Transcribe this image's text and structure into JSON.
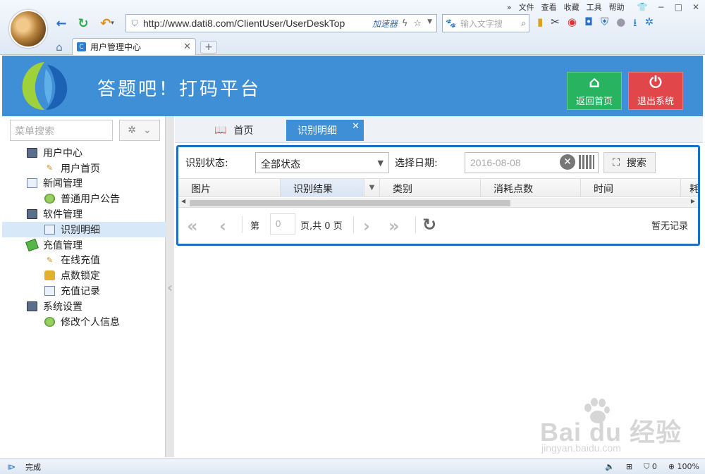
{
  "browser": {
    "menu": [
      "文件",
      "查看",
      "收藏",
      "工具",
      "帮助"
    ],
    "url": "http://www.dati8.com/ClientUser/UserDeskTop",
    "accelerator": "加速器",
    "search_placeholder": "输入文字搜",
    "tab_title": "用户管理中心",
    "tab_favicon": "C",
    "new_tab": "+"
  },
  "header": {
    "title": "答题吧！打码平台",
    "home_button": "返回首页",
    "exit_button": "退出系统"
  },
  "sidebar": {
    "search_placeholder": "菜单搜索",
    "items": [
      {
        "label": "用户中心",
        "level": 1,
        "icon": "computer-icon"
      },
      {
        "label": "用户首页",
        "level": 2,
        "icon": "pencil-icon"
      },
      {
        "label": "新闻管理",
        "level": 1,
        "icon": "document-icon"
      },
      {
        "label": "普通用户公告",
        "level": 2,
        "icon": "globe-icon"
      },
      {
        "label": "软件管理",
        "level": 1,
        "icon": "computer-icon"
      },
      {
        "label": "识别明细",
        "level": 2,
        "icon": "document-icon",
        "active": true
      },
      {
        "label": "充值管理",
        "level": 1,
        "icon": "money-icon"
      },
      {
        "label": "在线充值",
        "level": 2,
        "icon": "pencil-icon"
      },
      {
        "label": "点数锁定",
        "level": 2,
        "icon": "lock-icon"
      },
      {
        "label": "充值记录",
        "level": 2,
        "icon": "document-icon"
      },
      {
        "label": "系统设置",
        "level": 1,
        "icon": "computer-icon"
      },
      {
        "label": "修改个人信息",
        "level": 2,
        "icon": "globe-icon"
      }
    ]
  },
  "main": {
    "tabs": [
      {
        "label": "首页"
      },
      {
        "label": "识别明细"
      }
    ],
    "filter": {
      "status_label": "识别状态:",
      "status_value": "全部状态",
      "date_label": "选择日期:",
      "date_value": "2016-08-08",
      "search_button": "搜索"
    },
    "columns": [
      "图片",
      "识别结果",
      "类别",
      "消耗点数",
      "时间",
      "耗"
    ],
    "pager": {
      "page_prefix": "第",
      "page_value": "0",
      "page_suffix": "页,共 0 页",
      "no_records": "暂无记录"
    }
  },
  "watermark": {
    "main": "Bai du 经验",
    "sub": "jingyan.baidu.com"
  },
  "statusbar": {
    "status": "完成",
    "count": "0",
    "zoom": "100%"
  },
  "colors": {
    "header_bg": "#3f8fd6",
    "home_btn": "#27b35f",
    "exit_btn": "#e0464a",
    "active_tab": "#3f8fd6",
    "grid_border": "#1d6fc3"
  }
}
